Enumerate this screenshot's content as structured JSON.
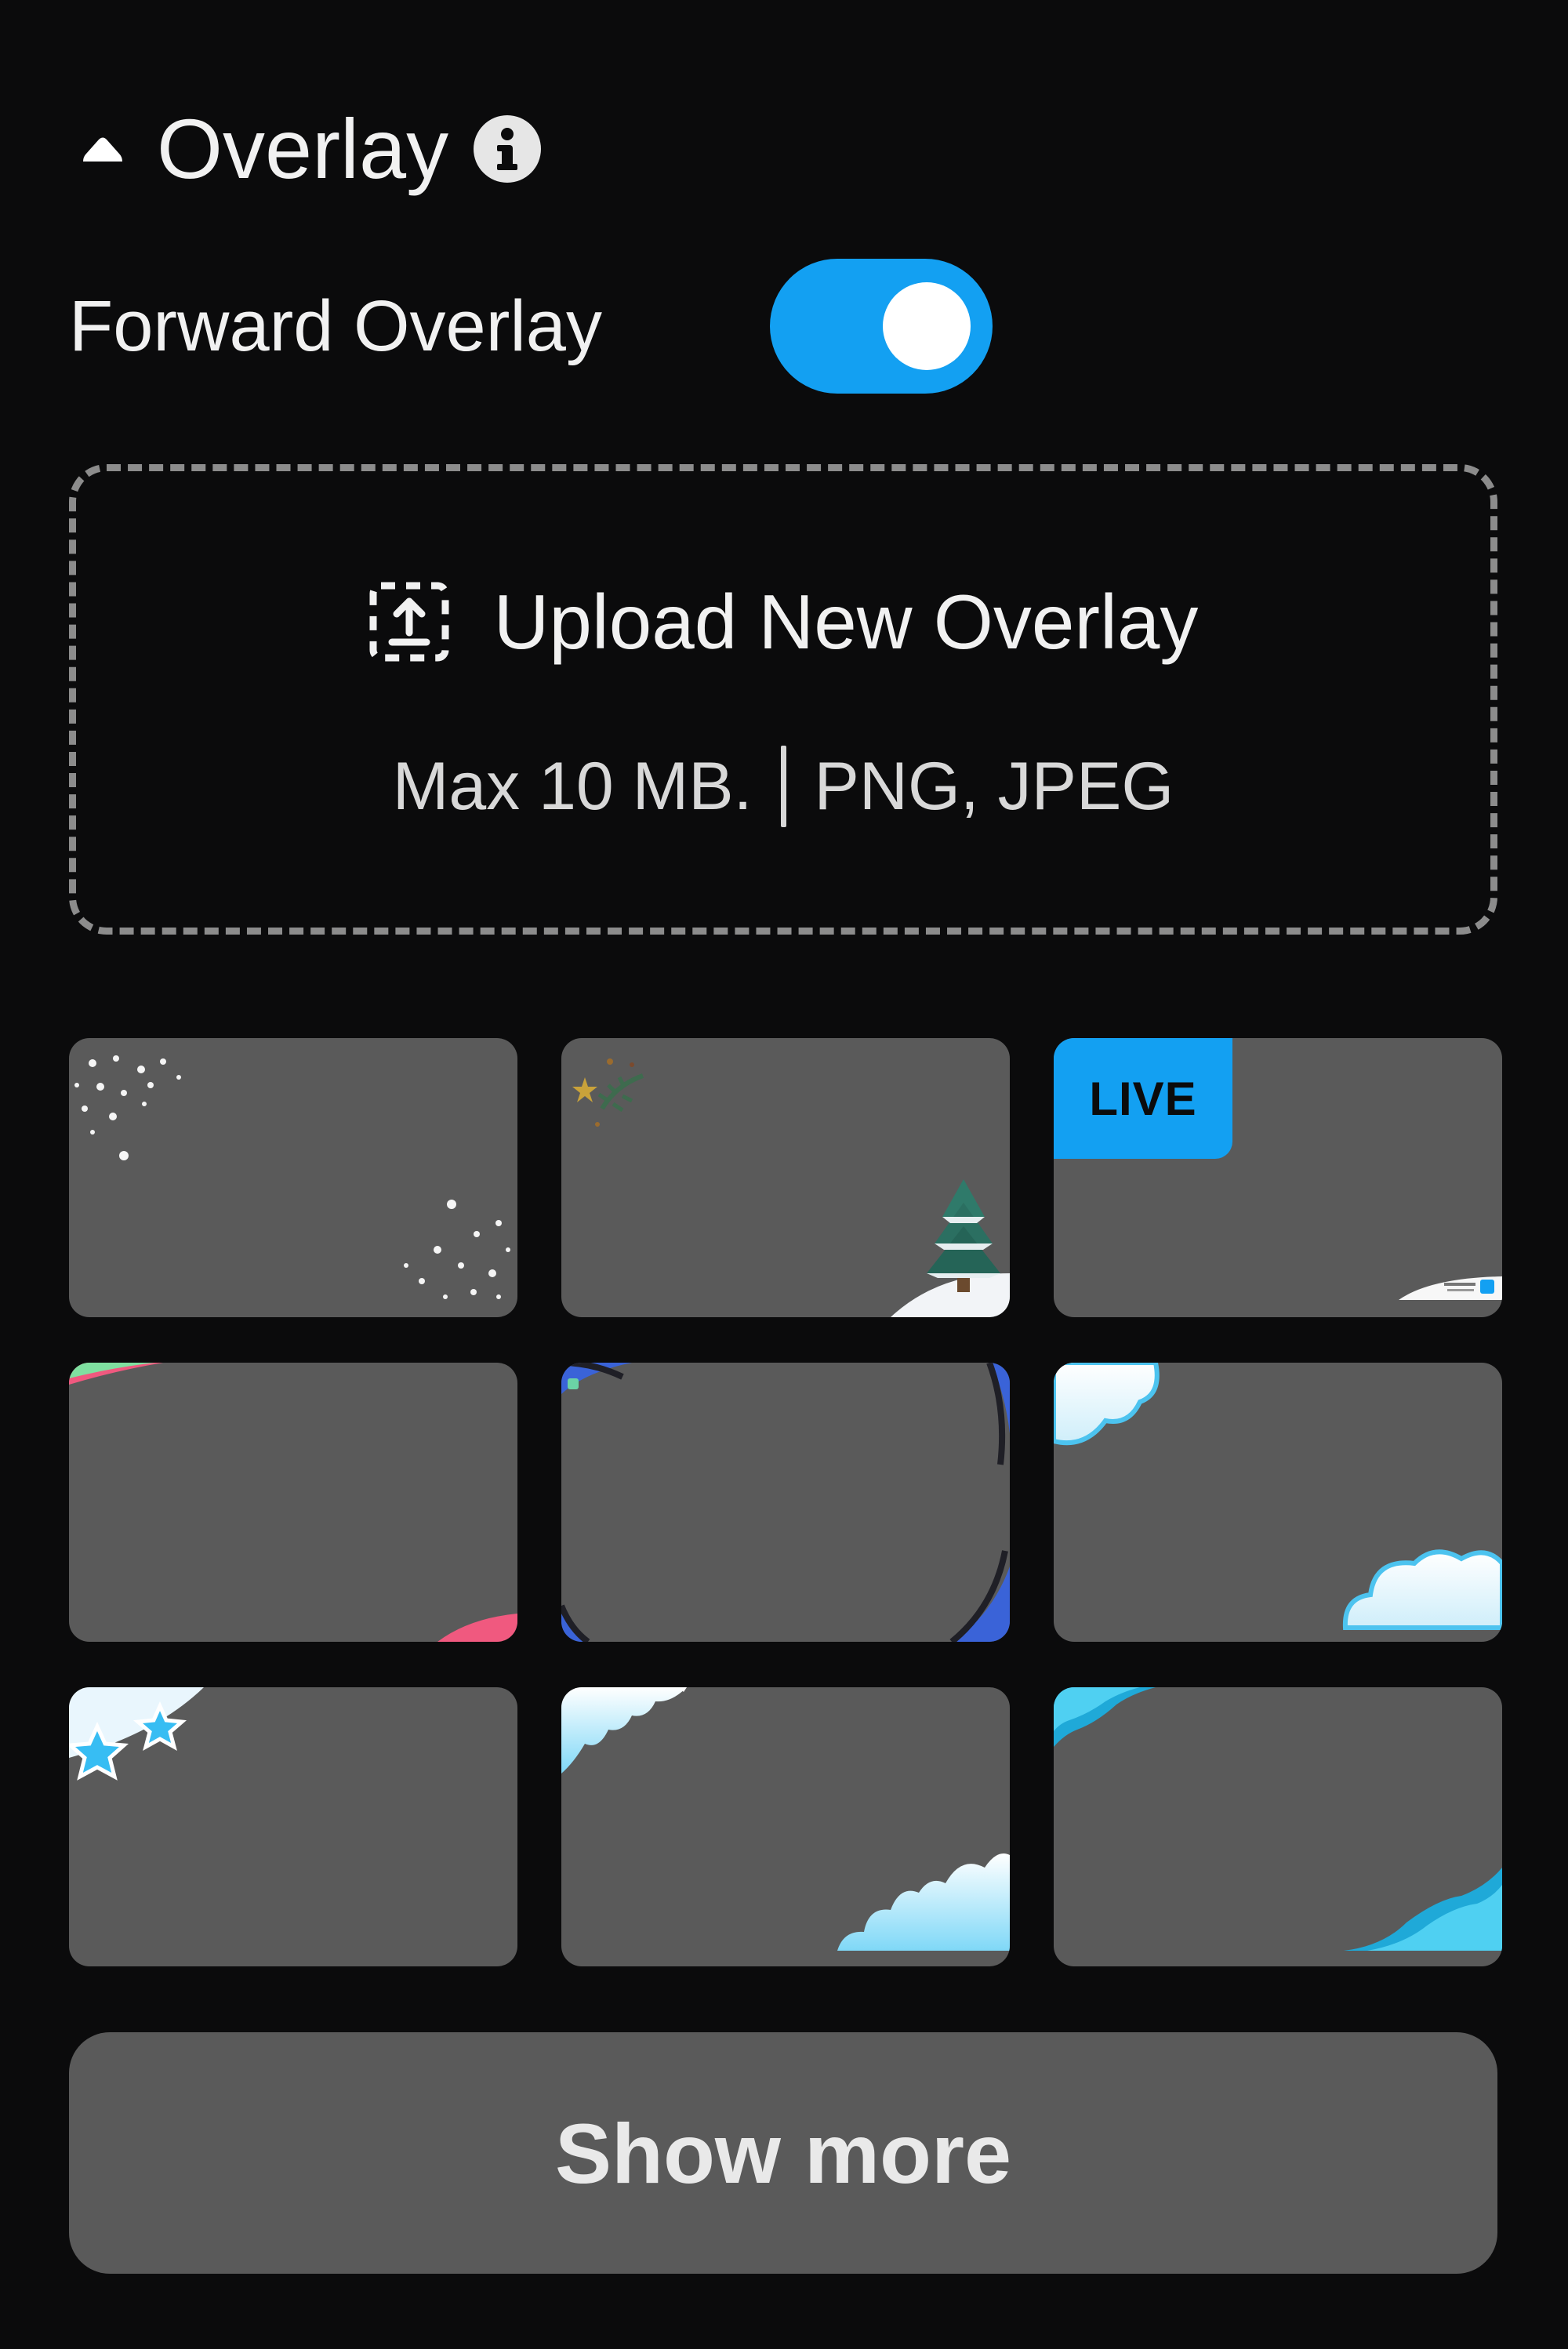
{
  "section": {
    "title": "Overlay",
    "collapse_icon": "caret-up-icon",
    "info_icon": "info-icon"
  },
  "forward_overlay": {
    "label": "Forward Overlay",
    "enabled": true,
    "accent": "#13a0f2"
  },
  "upload": {
    "icon": "upload-icon",
    "label": "Upload New Overlay",
    "max_size": "Max 10 MB.",
    "formats": "PNG, JPEG"
  },
  "overlays": [
    {
      "theme": "snow-sparkles"
    },
    {
      "theme": "christmas-tree"
    },
    {
      "theme": "live-badge",
      "badge": "LIVE"
    },
    {
      "theme": "pink-green-corners"
    },
    {
      "theme": "blue-circle-frame"
    },
    {
      "theme": "clouds"
    },
    {
      "theme": "blue-stars"
    },
    {
      "theme": "icy-waves"
    },
    {
      "theme": "blue-waves"
    }
  ],
  "show_more_label": "Show more",
  "colors": {
    "background": "#0b0b0c",
    "thumbnail": "#5a5a5a",
    "accent": "#13a0f2"
  }
}
